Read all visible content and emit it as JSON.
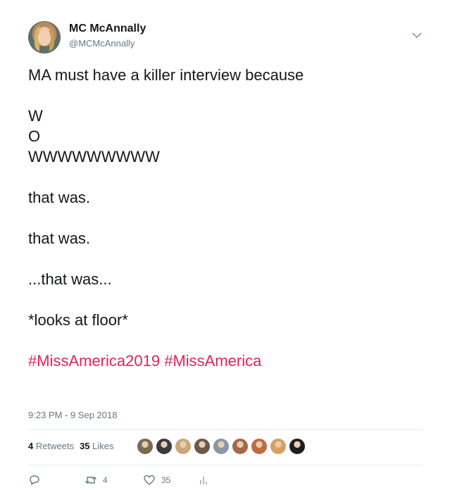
{
  "user": {
    "display_name": "MC McAnnally",
    "handle": "@MCMcAnnally"
  },
  "tweet": {
    "lines": [
      "MA must have a killer interview because",
      "",
      "W",
      "O",
      "WWWWWWWWW",
      "",
      "that was.",
      "",
      "that was.",
      "",
      "...that was...",
      "",
      "*looks at floor*",
      ""
    ],
    "hashtags": [
      "#MissAmerica2019",
      "#MissAmerica"
    ],
    "timestamp": "9:23 PM - 9 Sep 2018"
  },
  "stats": {
    "retweets_count": "4",
    "retweets_label": "Retweets",
    "likes_count": "35",
    "likes_label": "Likes"
  },
  "actions": {
    "reply_count": "",
    "retweet_count": "4",
    "like_count": "35"
  },
  "colors": {
    "hashtag": "#e0245e",
    "muted": "#657786",
    "divider": "#e6ecf0"
  },
  "likers": [
    {
      "name": "liker-avatar-1",
      "color": "#7a6a52"
    },
    {
      "name": "liker-avatar-2",
      "color": "#3d3a40"
    },
    {
      "name": "liker-avatar-3",
      "color": "#c9a77c"
    },
    {
      "name": "liker-avatar-4",
      "color": "#6b5a4a"
    },
    {
      "name": "liker-avatar-5",
      "color": "#8a98a8"
    },
    {
      "name": "liker-avatar-6",
      "color": "#a06c4c"
    },
    {
      "name": "liker-avatar-7",
      "color": "#c06a40"
    },
    {
      "name": "liker-avatar-8",
      "color": "#d8a060"
    },
    {
      "name": "liker-avatar-9",
      "color": "#1e1e22"
    }
  ]
}
